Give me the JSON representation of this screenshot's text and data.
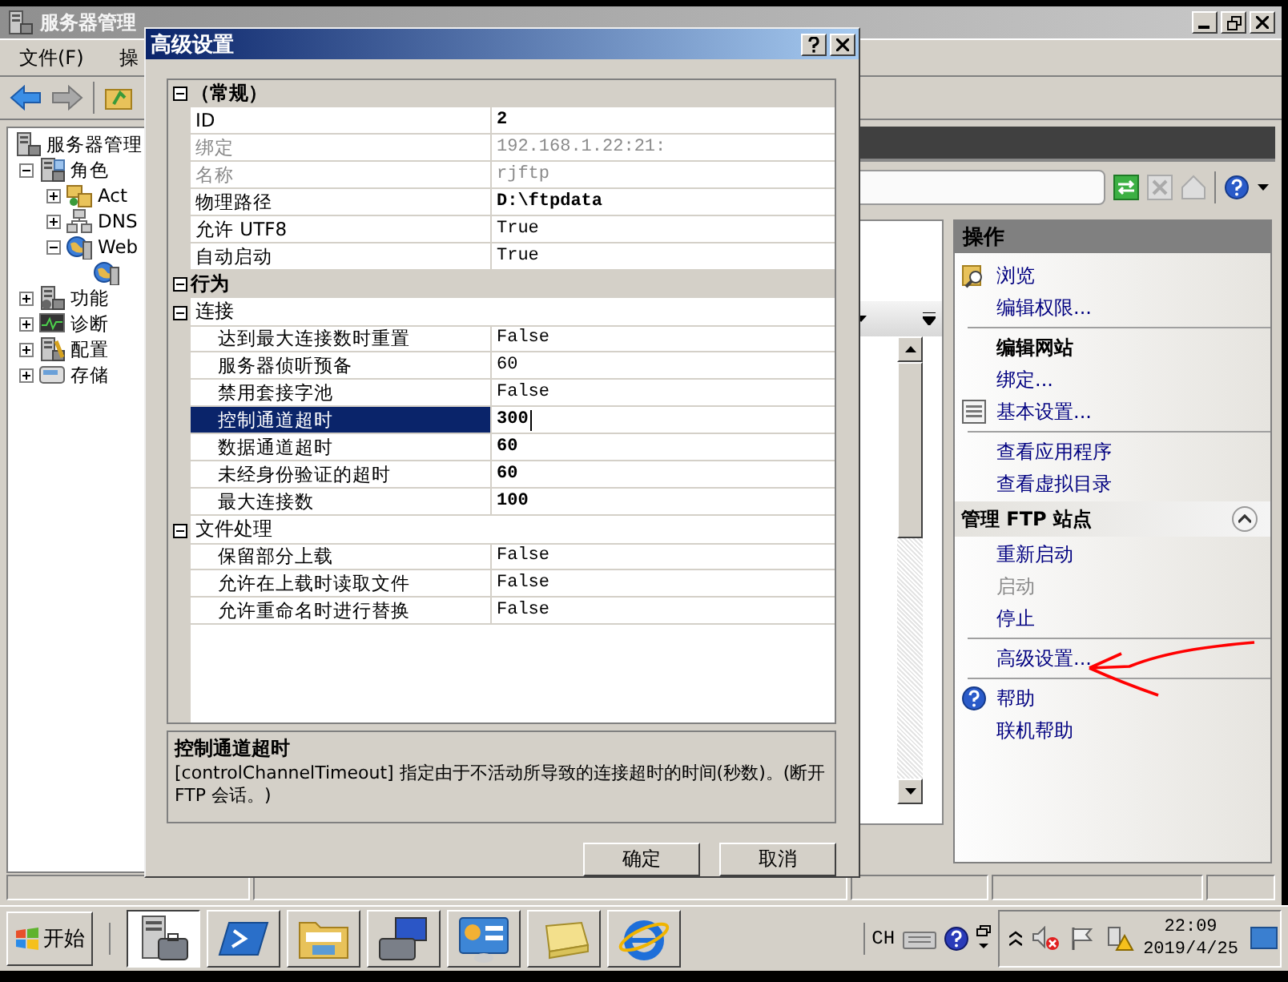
{
  "main_window": {
    "title": "服务器管理",
    "menu": [
      "文件(F)",
      "操"
    ],
    "tree": [
      {
        "kind": "server",
        "label": "服务器管理",
        "children": [
          {
            "kind": "roles",
            "label": "角色",
            "expanded": true,
            "children": [
              {
                "kind": "ad",
                "label": "Act",
                "expanded": false
              },
              {
                "kind": "dns",
                "label": "DNS",
                "expanded": false
              },
              {
                "kind": "web",
                "label": "Web",
                "expanded": true,
                "children": [
                  {
                    "kind": "site"
                  }
                ]
              }
            ]
          },
          {
            "kind": "features",
            "label": "功能",
            "expanded": false
          },
          {
            "kind": "diagnostics",
            "label": "诊断",
            "expanded": false
          },
          {
            "kind": "config",
            "label": "配置",
            "expanded": false
          },
          {
            "kind": "storage",
            "label": "存储",
            "expanded": false
          }
        ]
      }
    ],
    "actions": {
      "title": "操作",
      "items": [
        {
          "kind": "browse",
          "label": "浏览",
          "disabled": false
        },
        {
          "kind": "link",
          "label": "编辑权限...",
          "disabled": false
        },
        {
          "kind": "divider"
        },
        {
          "kind": "heading",
          "label": "编辑网站"
        },
        {
          "kind": "link",
          "label": "绑定...",
          "disabled": false
        },
        {
          "kind": "settings",
          "label": "基本设置...",
          "disabled": false
        },
        {
          "kind": "divider"
        },
        {
          "kind": "link",
          "label": "查看应用程序",
          "disabled": false
        },
        {
          "kind": "link",
          "label": "查看虚拟目录",
          "disabled": false
        },
        {
          "kind": "section",
          "label": "管理 FTP 站点",
          "expanded": true
        },
        {
          "kind": "link",
          "label": "重新启动",
          "disabled": false
        },
        {
          "kind": "link",
          "label": "启动",
          "disabled": true
        },
        {
          "kind": "link",
          "label": "停止",
          "disabled": false
        },
        {
          "kind": "divider"
        },
        {
          "kind": "link",
          "label": "高级设置...",
          "disabled": false
        },
        {
          "kind": "divider"
        },
        {
          "kind": "help",
          "label": "帮助",
          "disabled": false
        },
        {
          "kind": "link",
          "label": "联机帮助",
          "disabled": false
        }
      ]
    },
    "annotation": {
      "kind": "arrow"
    }
  },
  "dialog": {
    "title": "高级设置",
    "grid": [
      {
        "label": "（常规）",
        "expanded": true,
        "rows": [
          {
            "name": "ID",
            "value": "2",
            "modified": true,
            "readonly": false,
            "selected": false
          },
          {
            "name": "绑定",
            "value": "192.168.1.22:21:",
            "modified": false,
            "readonly": true,
            "selected": false
          },
          {
            "name": "名称",
            "value": "rjftp",
            "modified": false,
            "readonly": true,
            "selected": false
          },
          {
            "name": "物理路径",
            "value": "D:\\ftpdata",
            "modified": true,
            "readonly": false,
            "selected": false
          },
          {
            "name": "允许 UTF8",
            "value": "True",
            "modified": false,
            "readonly": false,
            "selected": false
          },
          {
            "name": "自动启动",
            "value": "True",
            "modified": false,
            "readonly": false,
            "selected": false
          }
        ]
      },
      {
        "label": "行为",
        "expanded": true,
        "groups": [
          {
            "label": "连接",
            "expanded": true,
            "rows": [
              {
                "name": "达到最大连接数时重置",
                "value": "False",
                "modified": false,
                "readonly": false,
                "selected": false
              },
              {
                "name": "服务器侦听预备",
                "value": "60",
                "modified": false,
                "readonly": false,
                "selected": false
              },
              {
                "name": "禁用套接字池",
                "value": "False",
                "modified": false,
                "readonly": false,
                "selected": false
              },
              {
                "name": "控制通道超时",
                "value": "300",
                "modified": true,
                "readonly": false,
                "selected": true
              },
              {
                "name": "数据通道超时",
                "value": "60",
                "modified": true,
                "readonly": false,
                "selected": false
              },
              {
                "name": "未经身份验证的超时",
                "value": "60",
                "modified": true,
                "readonly": false,
                "selected": false
              },
              {
                "name": "最大连接数",
                "value": "100",
                "modified": true,
                "readonly": false,
                "selected": false
              }
            ]
          },
          {
            "label": "文件处理",
            "expanded": true,
            "rows": [
              {
                "name": "保留部分上载",
                "value": "False",
                "modified": false,
                "readonly": false,
                "selected": false
              },
              {
                "name": "允许在上载时读取文件",
                "value": "False",
                "modified": false,
                "readonly": false,
                "selected": false
              },
              {
                "name": "允许重命名时进行替换",
                "value": "False",
                "modified": false,
                "readonly": false,
                "selected": false
              }
            ]
          }
        ]
      }
    ],
    "description": {
      "title": "控制通道超时",
      "text": "[controlChannelTimeout] 指定由于不活动所导致的连接超时的时间(秒数)。(断开 FTP 会话。)"
    },
    "buttons": [
      "确定",
      "取消"
    ]
  },
  "taskbar": {
    "start": "开始",
    "apps": [
      {
        "kind": "server-manager",
        "selected": true
      },
      {
        "kind": "powershell",
        "selected": false
      },
      {
        "kind": "explorer",
        "selected": false
      },
      {
        "kind": "computer",
        "selected": false
      },
      {
        "kind": "control-panel",
        "selected": false
      },
      {
        "kind": "notepad",
        "selected": false
      },
      {
        "kind": "browser",
        "selected": false
      }
    ],
    "language": "CH",
    "time": "22:09",
    "date": "2019/4/25"
  }
}
